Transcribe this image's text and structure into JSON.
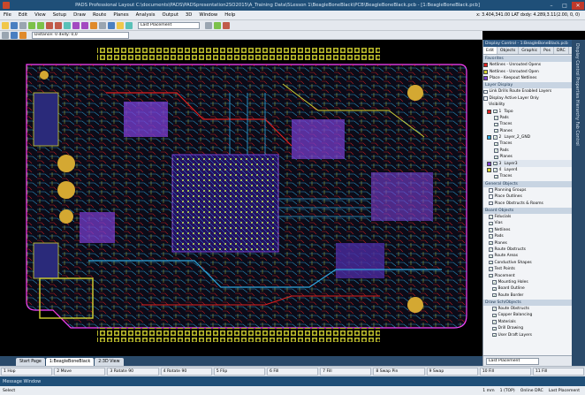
{
  "window": {
    "title": "PADS Professional Layout  C:\\documents\\PADS\\PADSpresentation2SO2015\\A_Training Data\\5Lesson 1\\BeagleBoneBlack\\PCB\\BeagleBoneBlack.pcb - [1:BeagleBoneBlack.pcb]"
  },
  "menu": {
    "items": [
      "File",
      "Edit",
      "View",
      "Setup",
      "Draw",
      "Route",
      "Planes",
      "Analysis",
      "Output",
      "3D",
      "Window",
      "Help"
    ],
    "coords": "x: 3.404,341.00 LAT  dxdy: 4.289,3.11(2.00, 0, 0)"
  },
  "toolbar": {
    "scheme": "Last Placement",
    "distance": "Distance: 0  dxdy: 0,0"
  },
  "tabs": [
    {
      "label": "Start Page"
    },
    {
      "label": "1:BeagleBoneBlack"
    },
    {
      "label": "2:3D View"
    }
  ],
  "fkeys": [
    "1 Hop",
    "2 Move",
    "3 Rotate 90",
    "4 Rotate 90",
    "5 Flip",
    "6 Fill",
    "7 Fill",
    "8 Swap Pin",
    "9 Swap",
    "10 Fill",
    "11 Fill"
  ],
  "message": {
    "title": "Message Window"
  },
  "status": {
    "left": "Select",
    "grid": "1 mm",
    "layer": "1 (TOP)",
    "mode": "Online DRC",
    "scheme": "Last Placement"
  },
  "panel": {
    "header": "Display Control - 1:BeagleBoneBlack.pcb",
    "tabs": [
      "Edit",
      "Objects",
      "Graphic",
      "Pos",
      "DRC",
      "3D"
    ],
    "sections": {
      "favorites": "Favorites",
      "layer_display": "Layer Display",
      "general": "General Objects",
      "board": "Board Objects",
      "drawing": "Draw Sch/Objects"
    },
    "favorites": [
      "Netlines - Unrouted Opens",
      "Netlines - Unrouted Open",
      "Place - Keepout Netlines"
    ],
    "layer_opts": [
      "Link Drills Route Enabled Layers",
      "Display Active Layer Only",
      "Visibility"
    ],
    "layers": [
      {
        "name": "Topo",
        "num": "1"
      },
      {
        "name": "Pads",
        "num": ""
      },
      {
        "name": "Traces",
        "num": ""
      },
      {
        "name": "Planes",
        "num": ""
      },
      {
        "name": "Layer_2_GND",
        "num": "2"
      },
      {
        "name": "Traces",
        "num": ""
      },
      {
        "name": "Pads",
        "num": ""
      },
      {
        "name": "Planes",
        "num": ""
      },
      {
        "name": "Layer3",
        "num": "3"
      },
      {
        "name": "Layer4",
        "num": "4"
      },
      {
        "name": "Traces",
        "num": ""
      }
    ],
    "general": [
      "Planning Groups",
      "Place Outlines",
      "Place Obstructs & Rooms"
    ],
    "board": [
      "Fiducials",
      "Vias",
      "Netlines",
      "Pads",
      "Planes",
      "Route Obstructs",
      "Route Areas",
      "Conductive Shapes",
      "Test Points"
    ],
    "placement": [
      "Placement",
      "Mounting Holes",
      "Board Outline",
      "Route Border"
    ],
    "drawing": [
      "Route Obstructs",
      "Copper Balancing",
      "Materials",
      "Drill Drawing",
      "User Draft Layers"
    ],
    "bottom": "Last Placement"
  },
  "sidestrip": {
    "label": "Display Control   Properties   Hierarchy   Fab Control"
  },
  "colors": {
    "title": "#1f4f78",
    "copper_top": "#e02020",
    "copper_inner": "#2fa8e0",
    "pads": "#d4d432",
    "planes": "#7a3fd4",
    "outline": "#ff40ff"
  }
}
